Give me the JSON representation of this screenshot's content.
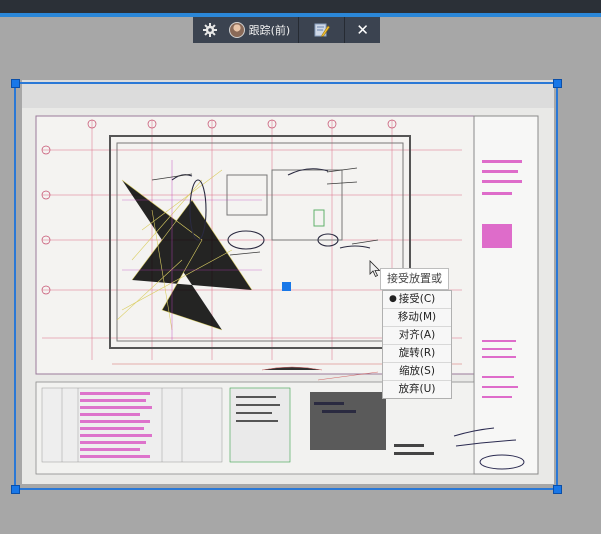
{
  "toolbar": {
    "track_label": "跟踪(前)",
    "close_glyph": "✕",
    "icons": [
      "gear-icon",
      "user-avatar",
      "edit-markup-icon",
      "close-icon"
    ]
  },
  "tooltip": {
    "text": "接受放置或"
  },
  "context_menu": {
    "items": [
      {
        "label": "接受(C)",
        "selected": true
      },
      {
        "label": "移动(M)",
        "selected": false
      },
      {
        "label": "对齐(A)",
        "selected": false
      },
      {
        "label": "旋转(R)",
        "selected": false
      },
      {
        "label": "缩放(S)",
        "selected": false
      },
      {
        "label": "放弃(U)",
        "selected": false
      }
    ],
    "bullet": "●"
  },
  "colors": {
    "accent": "#2b87d8",
    "toolbar_bg": "#3b4350",
    "selection": "#2a78d6"
  }
}
